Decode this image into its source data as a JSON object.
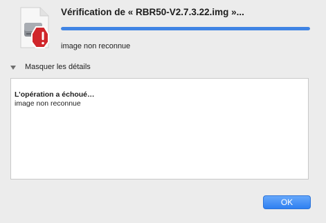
{
  "dialog": {
    "title": "Vérification de « RBR50-V2.7.3.22.img »...",
    "progress": 1.0,
    "status": "image non reconnue",
    "details_toggle_label": "Masquer les détails",
    "details_heading": "L’opération a échoué…",
    "details_text": "image non reconnue",
    "ok_label": "OK"
  },
  "colors": {
    "progress": "#3f84e4",
    "button": "#2e7ff1",
    "alert": "#d0262b"
  },
  "icons": {
    "document": "disk-image-icon",
    "badge": "alert-badge-icon",
    "toggle": "disclosure-triangle-icon"
  }
}
